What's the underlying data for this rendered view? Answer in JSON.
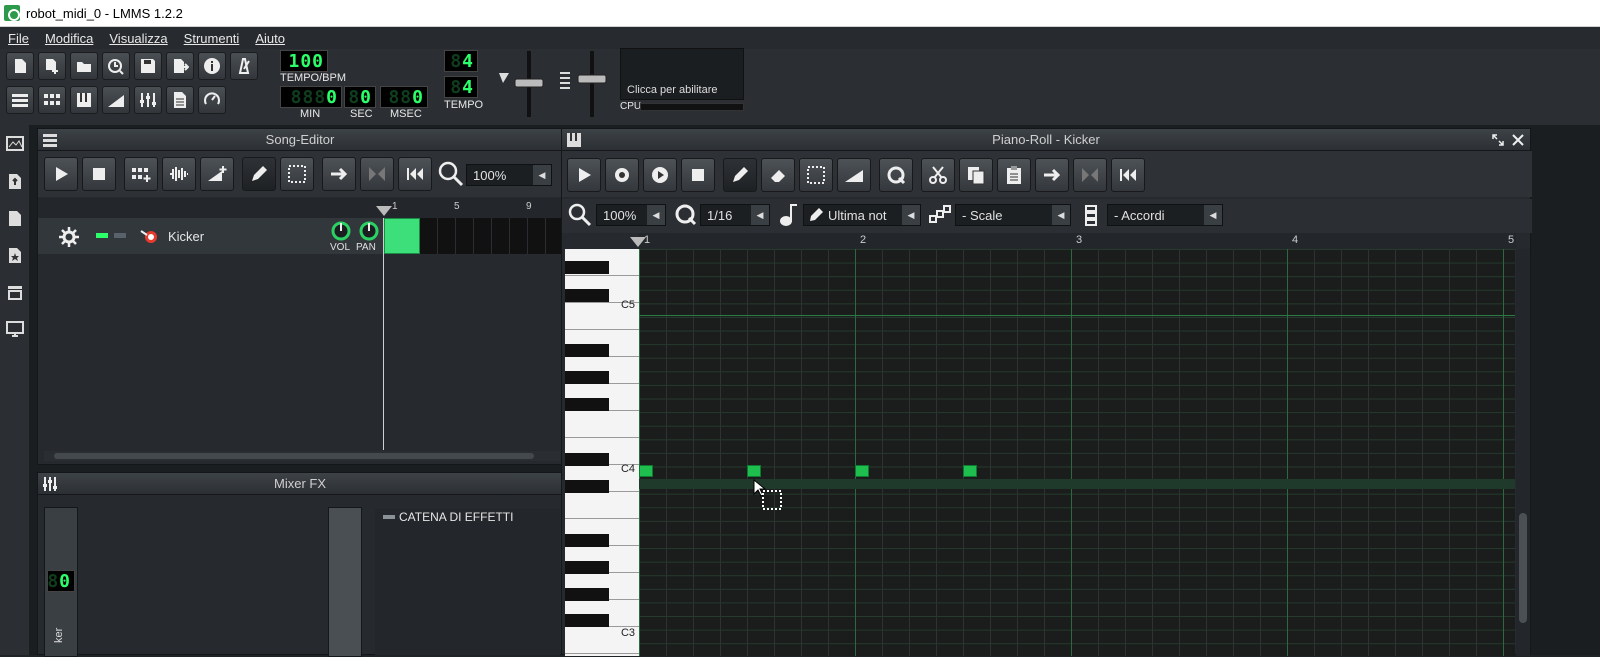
{
  "window": {
    "title": "robot_midi_0 - LMMS 1.2.2"
  },
  "menu": [
    "File",
    "Modifica",
    "Visualizza",
    "Strumenti",
    "Aiuto"
  ],
  "transport": {
    "tempo_value": "100",
    "tempo_label": "TEMPO/BPM",
    "min_value": "0",
    "min_dim": "888",
    "sec_value": "0",
    "sec_dim": "8",
    "msec_value": "0",
    "msec_dim": "88",
    "min_label": "MIN",
    "sec_label": "SEC",
    "msec_label": "MSEC",
    "timesig_num": "4",
    "timesig_den": "4",
    "timesig_label": "TEMPO",
    "cpu_hint": "Clicca per abilitare",
    "cpu_label": "CPU",
    "lcd_dim": "8"
  },
  "song_editor": {
    "title": "Song-Editor",
    "zoom": "100%",
    "timeline_marks": [
      "1",
      "5",
      "9"
    ],
    "track": {
      "name": "Kicker",
      "vol_label": "VOL",
      "pan_label": "PAN"
    }
  },
  "mixer": {
    "title": "Mixer FX",
    "effects_chain_label": "CATENA DI EFFETTI",
    "channel_value": "0",
    "channel_dim": "8",
    "channel_label": "ker"
  },
  "piano_roll": {
    "title": "Piano-Roll - Kicker",
    "zoom": "100%",
    "quantize": "1/16",
    "note_length": "Ultima not",
    "scale": "- Scale",
    "chords": "- Accordi",
    "timeline_marks": [
      "1",
      "2",
      "3",
      "4",
      "5"
    ],
    "key_labels": [
      "C5",
      "C4",
      "C3"
    ]
  },
  "colors": {
    "accent_green": "#2bff6a",
    "note_green": "#1fbf4f",
    "grid_bg": "#1a1d1c"
  }
}
